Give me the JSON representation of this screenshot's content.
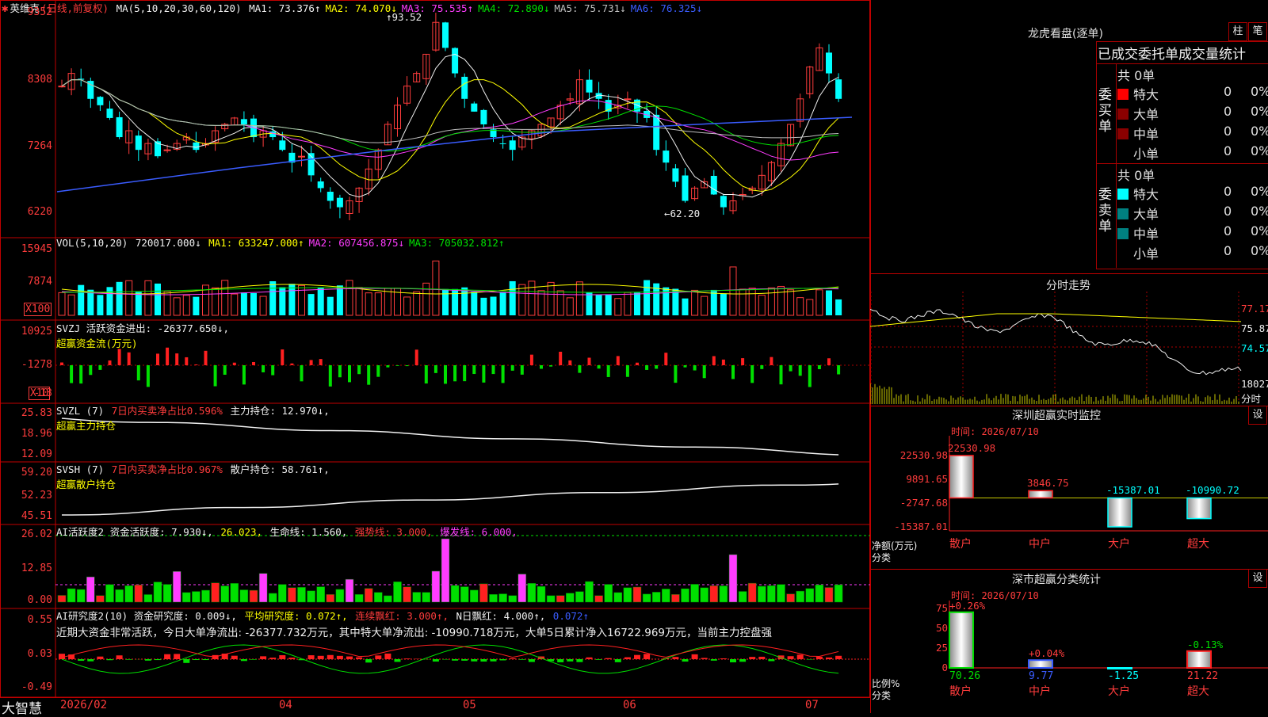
{
  "stock": {
    "name": "英维克",
    "mode": "(日线,前复权)",
    "ma_header": "MA(5,10,20,30,60,120)",
    "ma": [
      {
        "label": "MA1: 73.376↑",
        "color": "#f0f0f0"
      },
      {
        "label": "MA2: 74.070↓",
        "color": "#ffff00"
      },
      {
        "label": "MA3: 75.535↑",
        "color": "#ff3cff"
      },
      {
        "label": "MA4: 72.890↓",
        "color": "#00e000"
      },
      {
        "label": "MA5: 75.731↓",
        "color": "#c0c0c0"
      },
      {
        "label": "MA6: 76.325↓",
        "color": "#3a5cff"
      }
    ],
    "high_mark": "93.52",
    "low_mark": "←62.20",
    "yticks": [
      "9352",
      "8308",
      "7264",
      "6220"
    ]
  },
  "vol": {
    "header": "VOL(5,10,20)",
    "value": "720017.000↓",
    "ma": [
      {
        "label": "MA1: 633247.000↑",
        "color": "#ffff00"
      },
      {
        "label": "MA2: 607456.875↓",
        "color": "#ff3cff"
      },
      {
        "label": "MA3: 705032.812↑",
        "color": "#00e000"
      }
    ],
    "yticks": [
      "15945",
      "7874"
    ],
    "unit": "X100"
  },
  "svzj": {
    "header": "SVZJ  活跃资金进出: -26377.650↓,",
    "sub": "超赢资金流(万元)",
    "yticks": [
      "10925",
      "-1278",
      "-13"
    ],
    "unit": "X10"
  },
  "svzl": {
    "header_a": "SVZL (7)",
    "header_b": "7日内买卖净占比0.596%",
    "header_c": "主力持仓: 12.970↓,",
    "sub": "超赢主力持仓",
    "yticks": [
      "25.83",
      "18.96",
      "12.09"
    ]
  },
  "svsh": {
    "header_a": "SVSH (7)",
    "header_b": "7日内买卖净占比0.967%",
    "header_c": "散户持仓: 58.761↑,",
    "sub": "超赢散户持仓",
    "yticks": [
      "59.20",
      "52.23",
      "45.51"
    ]
  },
  "ai1": {
    "h1": "AI活跃度2 资金活跃度: 7.930↓,",
    "h2": "26.023,",
    "h3": "生命线: 1.560,",
    "h4": "强势线: 3.000,",
    "h5": "爆发线: 6.000,",
    "yticks": [
      "26.02",
      "12.85",
      "0.00"
    ]
  },
  "ai2": {
    "h1": "AI研究度2(10) 资金研究度: 0.009↓,",
    "h2": "平均研究度: 0.072↑,",
    "h3": "连续飘红: 3.000↑,",
    "h4": "N日飘红: 4.000↑,",
    "h5": "0.072↑",
    "comment": "近期大资金非常活跃，今日大单净流出: -26377.732万元，其中特大单净流出: -10990.718万元，大单5日累计净入16722.969万元，当前主力控盘强",
    "yticks": [
      "0.55",
      "0.03",
      "-0.49"
    ]
  },
  "xaxis": {
    "labels": [
      "2026/02",
      "04",
      "05",
      "06",
      "07"
    ]
  },
  "footer": {
    "brand": "大智慧"
  },
  "longhu": {
    "title": "龙虎看盘(逐单)",
    "btn_a": "柱",
    "btn_b": "笔",
    "subtitle": "已成交委托单成交量统计",
    "buy_label": "委买单",
    "sell_label": "委卖单",
    "buy_total": "共 0单",
    "sell_total": "共 0单",
    "buy_rows": [
      {
        "name": "特大",
        "count": "0",
        "pct": "0%"
      },
      {
        "name": "大单",
        "count": "0",
        "pct": "0%"
      },
      {
        "name": "中单",
        "count": "0",
        "pct": "0%"
      },
      {
        "name": "小单",
        "count": "0",
        "pct": "0%"
      }
    ],
    "sell_rows": [
      {
        "name": "特大",
        "count": "0",
        "pct": "0%"
      },
      {
        "name": "大单",
        "count": "0",
        "pct": "0%"
      },
      {
        "name": "中单",
        "count": "0",
        "pct": "0%"
      },
      {
        "name": "小单",
        "count": "0",
        "pct": "0%"
      }
    ]
  },
  "intraday": {
    "title": "分时走势",
    "yticks": [
      "77.17",
      "75.87",
      "74.57"
    ],
    "vol_tick": "18027",
    "unit": "分时"
  },
  "monitor": {
    "title": "深圳超赢实时监控",
    "btn": "设",
    "time": "时间: 2026/07/10",
    "yticks": [
      "22530.98",
      "9891.65",
      "-2747.68",
      "-15387.01"
    ],
    "ylabel1": "净额(万元)",
    "ylabel2": "分类",
    "categories": [
      "散户",
      "中户",
      "大户",
      "超大"
    ],
    "values": [
      22530.98,
      3846.75,
      -15387.01,
      -10990.72
    ],
    "value_labels": [
      "22530.98",
      "3846.75",
      "-15387.01",
      "-10990.72"
    ]
  },
  "classify": {
    "title": "深市超赢分类统计",
    "btn": "设",
    "time": "时间: 2026/07/10",
    "yticks": [
      "75",
      "50",
      "25",
      "0"
    ],
    "ylabel1": "比例%",
    "ylabel2": "分类",
    "categories": [
      "散户",
      "中户",
      "大户",
      "超大"
    ],
    "values": [
      70.26,
      9.77,
      -1.25,
      21.22
    ],
    "value_labels": [
      "70.26",
      "9.77",
      "-1.25",
      "21.22"
    ],
    "top_labels": [
      "+0.26%",
      "+0.04%",
      "",
      "-0.13%"
    ]
  }
}
